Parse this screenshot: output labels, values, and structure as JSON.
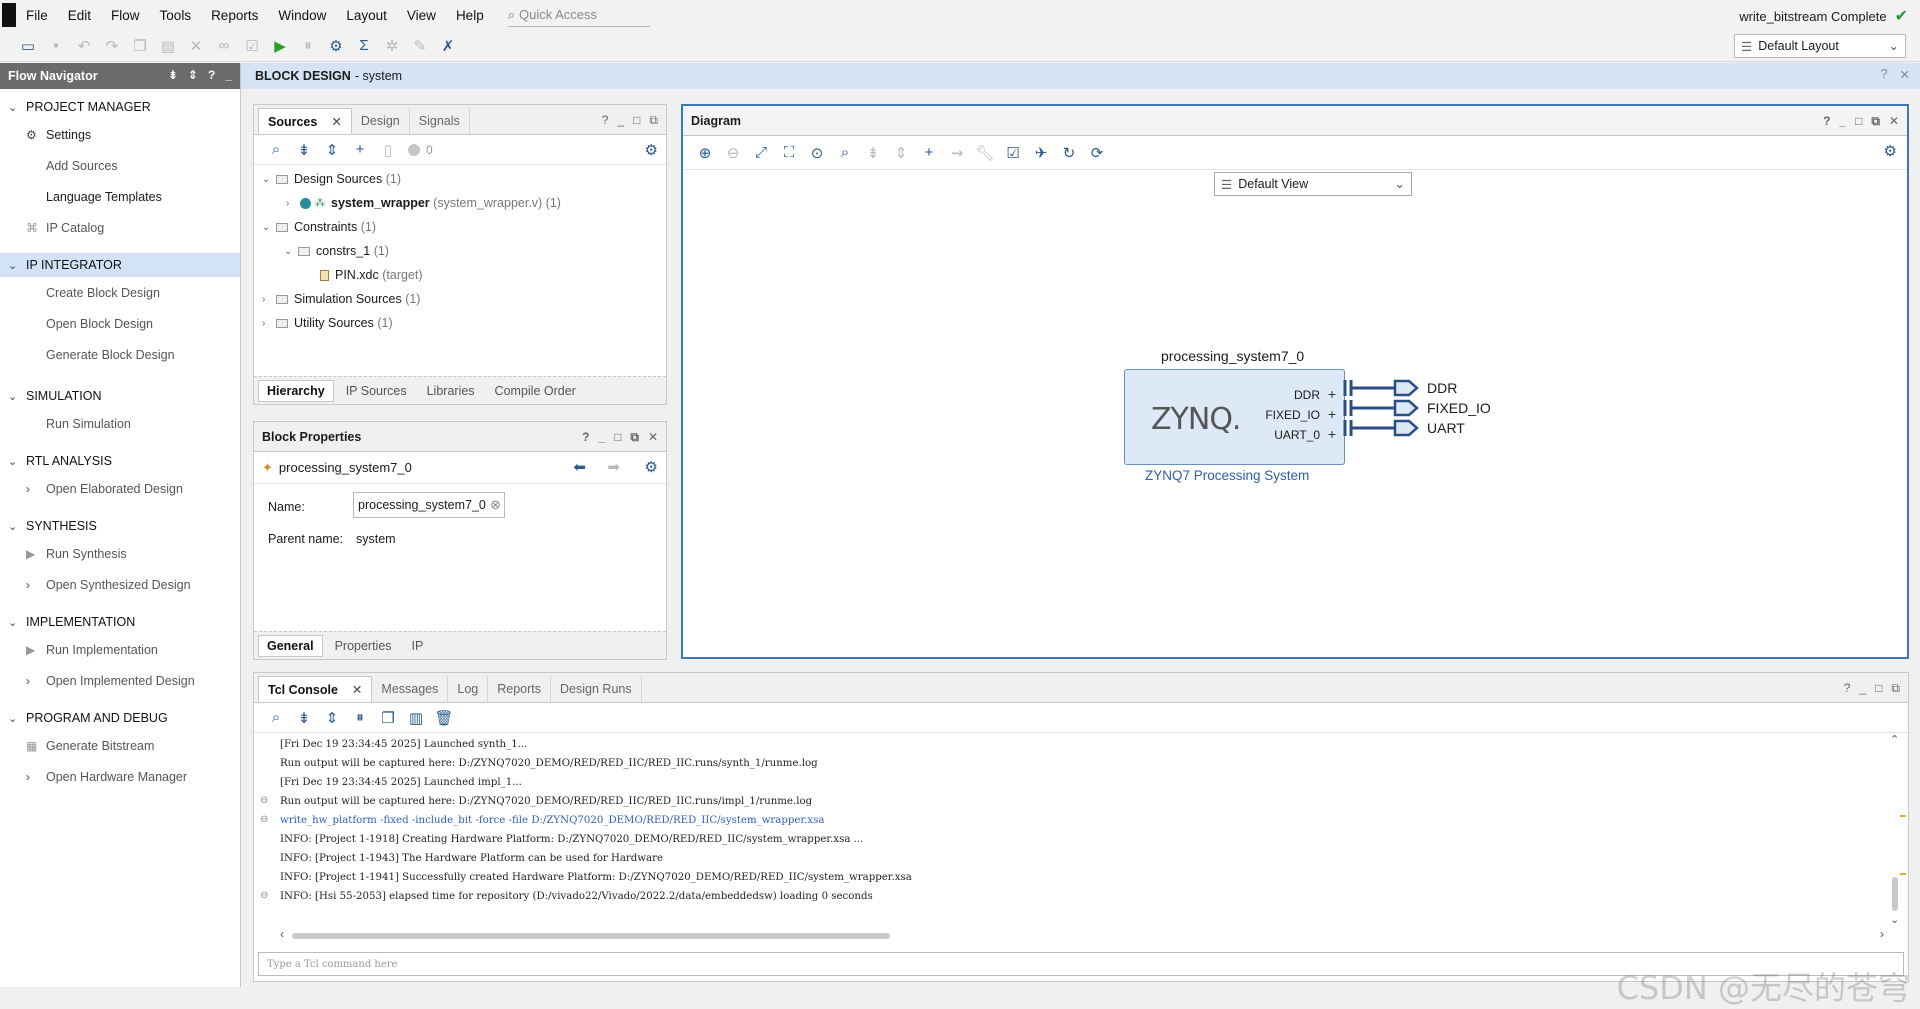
{
  "menubar": {
    "items": [
      "File",
      "Edit",
      "Flow",
      "Tools",
      "Reports",
      "Window",
      "Layout",
      "View",
      "Help"
    ],
    "quick_access_placeholder": "Quick Access",
    "status": "write_bitstream Complete"
  },
  "toolbar": {
    "layout_select": "Default Layout"
  },
  "flow_navigator": {
    "title": "Flow Navigator",
    "sections": [
      {
        "label": "PROJECT MANAGER",
        "items": [
          "Settings",
          "Add Sources",
          "Language Templates",
          "IP Catalog"
        ]
      },
      {
        "label": "IP INTEGRATOR",
        "items": [
          "Create Block Design",
          "Open Block Design",
          "Generate Block Design"
        ]
      },
      {
        "label": "SIMULATION",
        "items": [
          "Run Simulation"
        ]
      },
      {
        "label": "RTL ANALYSIS",
        "items": [
          "Open Elaborated Design"
        ]
      },
      {
        "label": "SYNTHESIS",
        "items": [
          "Run Synthesis",
          "Open Synthesized Design"
        ]
      },
      {
        "label": "IMPLEMENTATION",
        "items": [
          "Run Implementation",
          "Open Implemented Design"
        ]
      },
      {
        "label": "PROGRAM AND DEBUG",
        "items": [
          "Generate Bitstream",
          "Open Hardware Manager"
        ]
      }
    ]
  },
  "block_design": {
    "title": "BLOCK DESIGN",
    "name": "- system"
  },
  "sources": {
    "tabs": [
      "Sources",
      "Design",
      "Signals"
    ],
    "count": "0",
    "tree": {
      "design_sources": "Design Sources",
      "design_sources_count": "(1)",
      "system_wrapper": "system_wrapper",
      "system_wrapper_detail": "(system_wrapper.v) (1)",
      "constraints": "Constraints",
      "constraints_count": "(1)",
      "constrs_1": "constrs_1",
      "constrs_1_count": "(1)",
      "pin_xdc": "PIN.xdc",
      "pin_xdc_detail": "(target)",
      "simulation_sources": "Simulation Sources",
      "simulation_sources_count": "(1)",
      "utility_sources": "Utility Sources",
      "utility_sources_count": "(1)"
    },
    "bottom_tabs": [
      "Hierarchy",
      "IP Sources",
      "Libraries",
      "Compile Order"
    ]
  },
  "block_properties": {
    "title": "Block Properties",
    "selected": "processing_system7_0",
    "name_label": "Name:",
    "name_value": "processing_system7_0",
    "parent_label": "Parent name:",
    "parent_value": "system",
    "bottom_tabs": [
      "General",
      "Properties",
      "IP"
    ]
  },
  "diagram": {
    "title": "Diagram",
    "view_select": "Default View",
    "block": {
      "instance_name": "processing_system7_0",
      "logo": "ZYNQ.",
      "subtitle": "ZYNQ7 Processing System",
      "ports": [
        "DDR",
        "FIXED_IO",
        "UART_0"
      ],
      "external_ports": [
        "DDR",
        "FIXED_IO",
        "UART"
      ]
    },
    "colors": {
      "block_fill": "#dde9f7",
      "block_border": "#6a8fbf",
      "wire": "#2a4f86"
    }
  },
  "console": {
    "tabs": [
      "Tcl Console",
      "Messages",
      "Log",
      "Reports",
      "Design Runs"
    ],
    "lines": [
      {
        "text": "[Fri Dec 19 23:34:45 2025] Launched synth_1...",
        "type": "normal"
      },
      {
        "text": "Run output will be captured here: D:/ZYNQ7020_DEMO/RED/RED_IIC/RED_IIC.runs/synth_1/runme.log",
        "type": "normal"
      },
      {
        "text": "[Fri Dec 19 23:34:45 2025] Launched impl_1...",
        "type": "normal"
      },
      {
        "text": "Run output will be captured here: D:/ZYNQ7020_DEMO/RED/RED_IIC/RED_IIC.runs/impl_1/runme.log",
        "type": "normal"
      },
      {
        "text": "write_hw_platform -fixed -include_bit -force -file D:/ZYNQ7020_DEMO/RED/RED_IIC/system_wrapper.xsa",
        "type": "cmd"
      },
      {
        "text": "INFO: [Project 1-1918] Creating Hardware Platform: D:/ZYNQ7020_DEMO/RED/RED_IIC/system_wrapper.xsa ...",
        "type": "normal"
      },
      {
        "text": "INFO: [Project 1-1943] The Hardware Platform can be used for Hardware",
        "type": "normal"
      },
      {
        "text": "INFO: [Project 1-1941] Successfully created Hardware Platform: D:/ZYNQ7020_DEMO/RED/RED_IIC/system_wrapper.xsa",
        "type": "normal"
      },
      {
        "text": "INFO: [Hsi 55-2053] elapsed time for repository (D:/vivado22/Vivado/2022.2/data/embeddedsw) loading 0 seconds",
        "type": "normal"
      }
    ],
    "input_placeholder": "Type a Tcl command here"
  },
  "watermark": "CSDN @无尽的苍穹"
}
